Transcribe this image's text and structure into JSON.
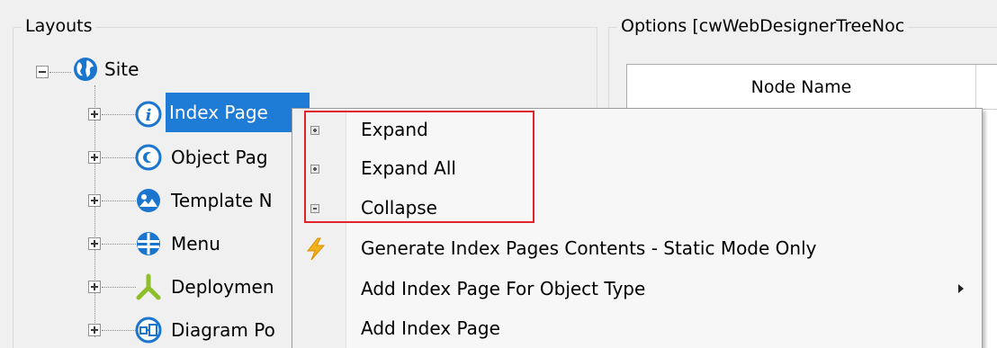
{
  "layouts_panel": {
    "title": "Layouts",
    "tree": [
      {
        "label": "Site",
        "icon": "globe-icon"
      },
      {
        "label": "Index Page",
        "icon": "info-icon"
      },
      {
        "label": "Object Pag",
        "icon": "object-icon"
      },
      {
        "label": "Template N",
        "icon": "template-icon"
      },
      {
        "label": "Menu",
        "icon": "menu-icon"
      },
      {
        "label": "Deploymen",
        "icon": "deployment-icon"
      },
      {
        "label": "Diagram Po",
        "icon": "diagram-icon"
      }
    ]
  },
  "options_panel": {
    "title": "Options [cwWebDesignerTreeNoc",
    "column_header": "Node Name"
  },
  "context_menu": {
    "items": [
      {
        "label": "Expand",
        "icon": "expand-icon"
      },
      {
        "label": "Expand All",
        "icon": "expand-all-icon"
      },
      {
        "label": "Collapse",
        "icon": "collapse-icon"
      },
      {
        "label": "Generate Index Pages Contents - Static Mode Only",
        "icon": "lightning-icon"
      },
      {
        "label": "Add Index Page For Object Type",
        "icon": "",
        "submenu": true
      },
      {
        "label": "Add Index Page",
        "icon": ""
      }
    ]
  },
  "colors": {
    "selection": "#1e7bd6",
    "highlight_border": "#e0242a",
    "icon_blue": "#1a75cf",
    "icon_green": "#8ebf2a",
    "lightning": "#f2b21b"
  }
}
